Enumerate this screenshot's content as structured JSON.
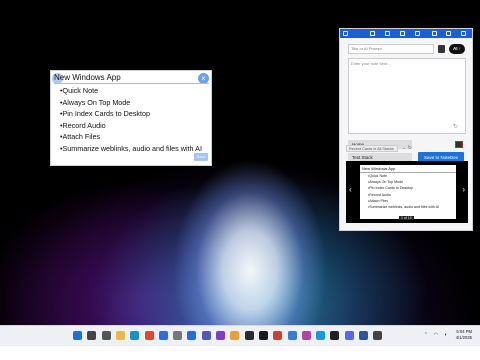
{
  "sticky_note": {
    "title": "New Windows App",
    "close_glyph": "×",
    "items": [
      "•Quick Note",
      "•Always On Top Mode",
      "•Pin Index Cards to Desktop",
      "•Record Audio",
      "•Attach Files",
      "•Summarize weblinks, audio and files with AI"
    ],
    "save_label": "Save"
  },
  "app_panel": {
    "prompt_placeholder": "Title or AI Prompt",
    "ai_button": "AI ↑",
    "note_placeholder": "Enter your note here...",
    "refresh_glyph": "↻",
    "home_label": "Home",
    "stack_label": "Test Stack",
    "save_button": "Save to NoteDex",
    "recent_label": "Recent Cards in All Stacks",
    "recent_icons": "⌄  ↻",
    "preview": {
      "title": "New Windows App",
      "items": [
        "•Quick Note",
        "•Always On Top Mode",
        "•Pin Index Cards to Desktop",
        "•Record Audio",
        "•Attach Files",
        "•Summarize weblinks, audio and files with AI"
      ],
      "counter": "1 of 10",
      "prev_glyph": "‹",
      "next_glyph": "›"
    }
  },
  "taskbar": {
    "icons": [
      "windows-start-icon",
      "search-icon",
      "task-view-icon",
      "folder-icon",
      "edge-icon",
      "chrome-icon",
      "store-icon",
      "settings-icon",
      "mail-icon",
      "teams-icon",
      "visual-studio-icon",
      "paint-icon",
      "camera-icon",
      "terminal-icon",
      "note-icon",
      "calendar-icon",
      "app-icon",
      "photos-icon",
      "github-icon",
      "discord-icon",
      "word-icon",
      "app2-icon"
    ],
    "icon_colors": [
      "#1b6fd6",
      "#444",
      "#555",
      "#e8b84a",
      "#1a8fd0",
      "#e94235",
      "#2d6cdf",
      "#777",
      "#1e6fd9",
      "#5558af",
      "#7b3fc6",
      "#e6a13b",
      "#2b2b2b",
      "#1a1a1a",
      "#d04030",
      "#3a7bd5",
      "#b3449e",
      "#1a9ad6",
      "#222",
      "#5865f2",
      "#2b579a",
      "#444"
    ],
    "time": "5:04 PM",
    "date": "4/1/2025"
  },
  "colors": {
    "accent": "#1f73d8",
    "title_bar": "#1d5fd1"
  }
}
